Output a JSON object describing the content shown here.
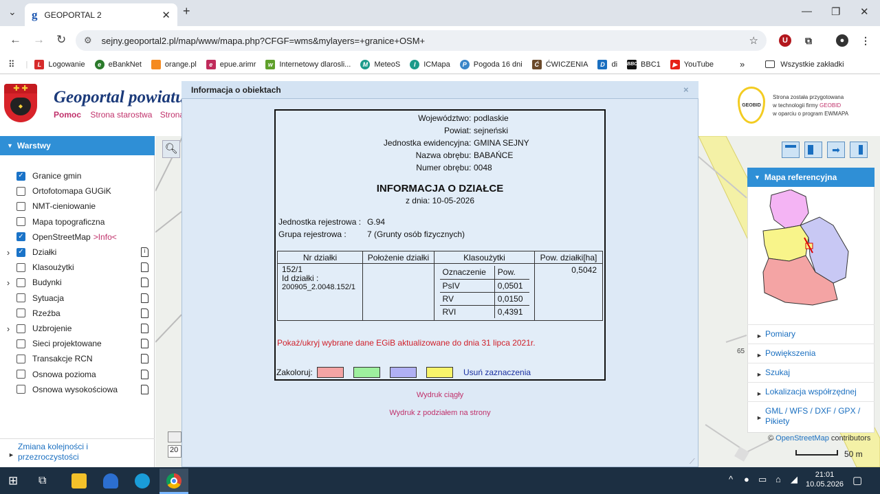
{
  "browser": {
    "tab_title": "GEOPORTAL 2",
    "tab_favicon": "g",
    "url": "sejny.geoportal2.pl/map/www/mapa.php?CFGF=wms&mylayers=+granice+OSM+",
    "bookmarks": [
      "Logowanie",
      "eBankNet",
      "orange.pl",
      "epue.arimr",
      "Internetowy dlarosli...",
      "MeteoS",
      "ICMapa",
      "Pogoda 16 dni",
      "ĆWICZENIA",
      "di",
      "BBC1",
      "YouTube"
    ],
    "all_bookmarks": "Wszystkie zakładki",
    "more": "»"
  },
  "header": {
    "title": "Geoportal powiatu",
    "links": [
      "Pomoc",
      "Strona starostwa",
      "Strona"
    ],
    "geobid_badge": "GEOBID",
    "geobid_text": [
      "Strona została przygotowana",
      "w technologii firmy",
      "GEOBID",
      "w oparciu o program EWMAPA"
    ]
  },
  "left_panel": {
    "title": "Warstwy",
    "layers": [
      {
        "label": "Granice gmin",
        "checked": true,
        "arrow": "",
        "doc": false
      },
      {
        "label": "Ortofotomapa GUGiK",
        "checked": false,
        "arrow": "",
        "doc": false
      },
      {
        "label": "NMT-cieniowanie",
        "checked": false,
        "arrow": "",
        "doc": false
      },
      {
        "label": "Mapa topograficzna",
        "checked": false,
        "arrow": "",
        "doc": false
      },
      {
        "label": "OpenStreetMap",
        "checked": true,
        "arrow": "",
        "doc": false,
        "suffix": ">Info<"
      },
      {
        "label": "Działki",
        "checked": true,
        "arrow": "›",
        "doc": true
      },
      {
        "label": "Klasoużytki",
        "checked": false,
        "arrow": "",
        "doc": true
      },
      {
        "label": "Budynki",
        "checked": false,
        "arrow": "›",
        "doc": true
      },
      {
        "label": "Sytuacja",
        "checked": false,
        "arrow": "",
        "doc": true
      },
      {
        "label": "Rzeźba",
        "checked": false,
        "arrow": "",
        "doc": true
      },
      {
        "label": "Uzbrojenie",
        "checked": false,
        "arrow": "›",
        "doc": true
      },
      {
        "label": "Sieci projektowane",
        "checked": false,
        "arrow": "",
        "doc": true
      },
      {
        "label": "Transakcje RCN",
        "checked": false,
        "arrow": "",
        "doc": true
      },
      {
        "label": "Osnowa pozioma",
        "checked": false,
        "arrow": "",
        "doc": true
      },
      {
        "label": "Osnowa wysokościowa",
        "checked": false,
        "arrow": "",
        "doc": true
      }
    ],
    "footer": [
      "Zmiana kolejności i",
      "przezroczystości"
    ]
  },
  "dialog": {
    "title": "Informacja o obiektach",
    "close": "×",
    "region": [
      {
        "label": "Województwo",
        "value": "podlaskie"
      },
      {
        "label": "Powiat",
        "value": "sejneński"
      },
      {
        "label": "Jednostka ewidencyjna",
        "value": "GMINA SEJNY"
      },
      {
        "label": "Nazwa obrębu",
        "value": "BABAŃCE"
      },
      {
        "label": "Numer obrębu",
        "value": "0048"
      }
    ],
    "info_title": "INFORMACJA O DZIAŁCE",
    "info_date": "z dnia: 10-05-2026",
    "jednostka_label": "Jednostka rejestrowa :",
    "jednostka_value": "G.94",
    "grupa_label": "Grupa rejestrowa :",
    "grupa_value": "7 (Grunty osób fizycznych)",
    "table_headers": [
      "Nr działki",
      "Położenie działki",
      "Klasoużytki",
      "Pow. działki[ha]"
    ],
    "nr_dzialki": "152/1",
    "id_label": "Id działki :",
    "id_value": "200905_2.0048.152/1",
    "klas_headers": [
      "Oznaczenie",
      "Pow."
    ],
    "klasouzytki": [
      {
        "oznaczenie": "PsIV",
        "pow": "0,0501"
      },
      {
        "oznaczenie": "RV",
        "pow": "0,0150"
      },
      {
        "oznaczenie": "RVI",
        "pow": "0,4391"
      }
    ],
    "pow_dzialki": "0,5042",
    "egib_note": "Pokaż/ukryj wybrane dane EGiB aktualizowane do dnia 31 lipca 2021r.",
    "zakoloruj": "Zakoloruj:",
    "swatch_colors": [
      "#f4a4a4",
      "#9ef09e",
      "#b0b0f4",
      "#f8f46a"
    ],
    "usun": "Usuń zaznaczenia",
    "print_continuous": "Wydruk ciągły",
    "print_pages": "Wydruk z podziałem na strony"
  },
  "right_panel": {
    "title": "Mapa referencyjna",
    "links": [
      "Pomiary",
      "Powiększenia",
      "Szukaj",
      "Lokalizacja współrzędnej",
      "GML / WFS / DXF / GPX / Pikiety"
    ]
  },
  "map": {
    "osm_link": "OpenStreetMap",
    "osm_contrib": "contributors",
    "scale": "50 m",
    "label_65": "65",
    "coord_box": "20"
  },
  "taskbar": {
    "time": "21:01",
    "date": "10.05.2026"
  },
  "colors": {
    "accent": "#2f8fd6",
    "link": "#c0306a"
  }
}
